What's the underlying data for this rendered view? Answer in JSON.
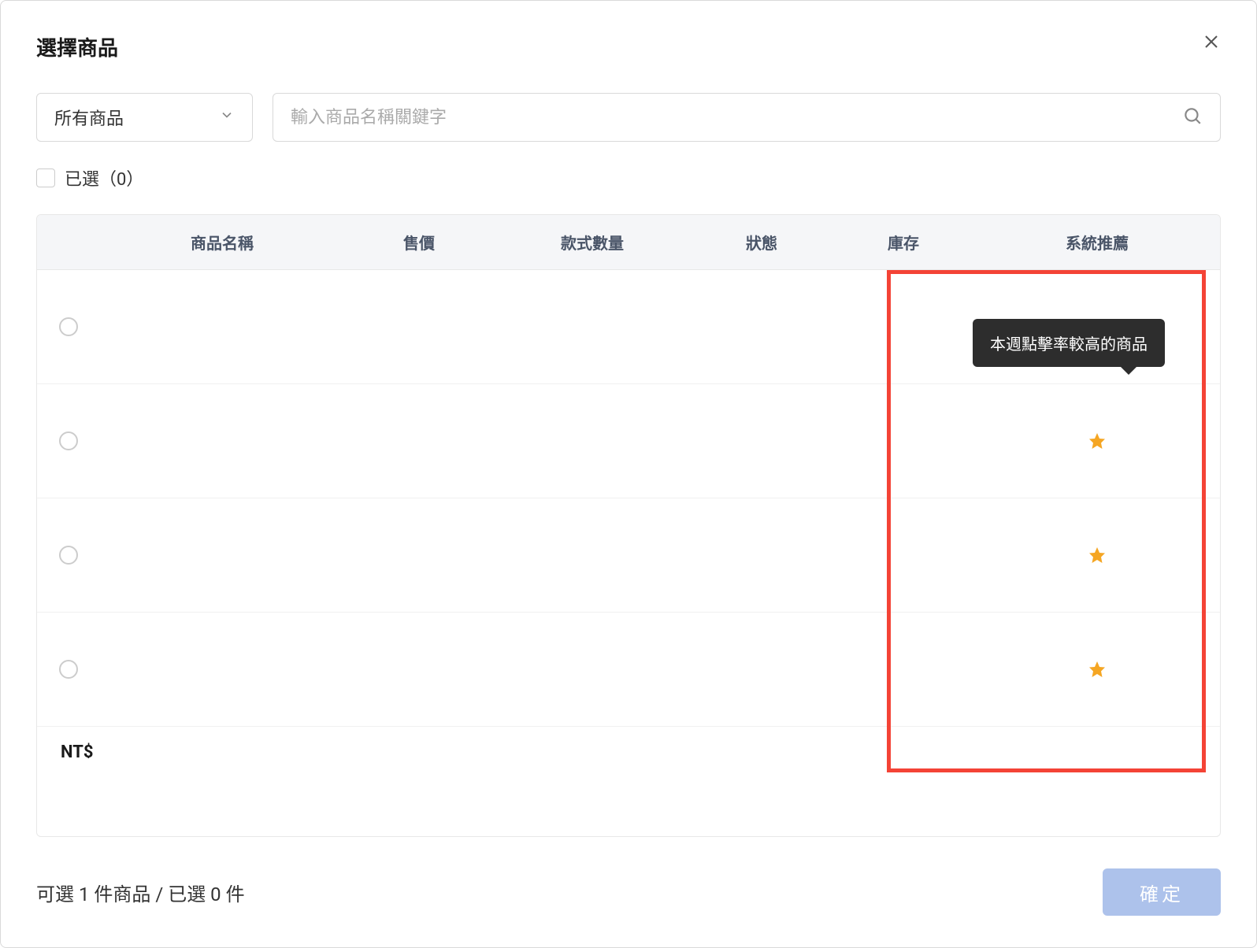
{
  "modal": {
    "title": "選擇商品"
  },
  "filter": {
    "category_selected": "所有商品",
    "search_placeholder": "輸入商品名稱關鍵字",
    "selected_label": "已選（0）"
  },
  "table": {
    "headers": {
      "name": "商品名稱",
      "price": "售價",
      "qty": "款式數量",
      "status": "狀態",
      "stock": "庫存",
      "recommend": "系統推薦"
    },
    "tooltip": "本週點擊率較高的商品",
    "rows": [
      {
        "recommended": true
      },
      {
        "recommended": true
      },
      {
        "recommended": true
      },
      {
        "recommended": true
      }
    ],
    "partial": {
      "price_prefix": "NT$"
    }
  },
  "footer": {
    "status_text": "可選 1 件商品 / 已選 0 件",
    "confirm_label": "確定"
  }
}
